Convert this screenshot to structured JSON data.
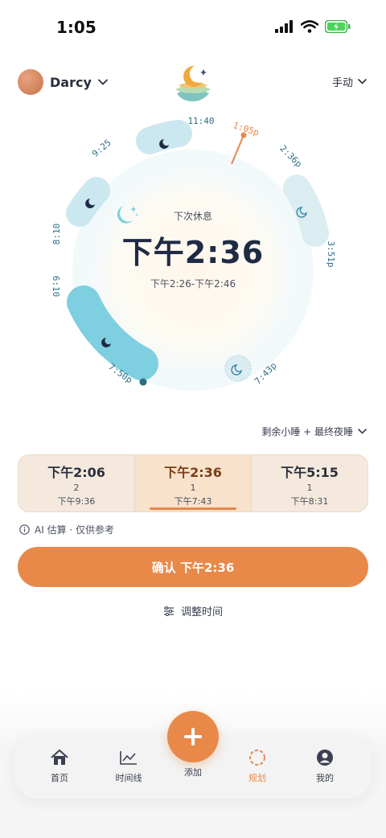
{
  "status": {
    "time": "1:05"
  },
  "header": {
    "profile_name": "Darcy",
    "mode_label": "手动"
  },
  "dial": {
    "tick_labels": [
      "11:40",
      "1:05p",
      "2:36p",
      "3:51p",
      "7:43p",
      "7:50p",
      "6:10",
      "8:10",
      "9:25"
    ],
    "center_label": "下次休息",
    "center_time": "下午2:36",
    "center_range": "下午2:26-下午2:46"
  },
  "dropdown_label": "剩余小睡 + 最终夜睡",
  "options": [
    {
      "time": "下午2:06",
      "count": "2",
      "bedtime": "下午9:36"
    },
    {
      "time": "下午2:36",
      "count": "1",
      "bedtime": "下午7:43"
    },
    {
      "time": "下午5:15",
      "count": "1",
      "bedtime": "下午8:31"
    }
  ],
  "ai_note": "AI 估算 · 仅供参考",
  "confirm_label": "确认 下午2:36",
  "adjust_label": "调整时间",
  "tabs": [
    {
      "label": "首页",
      "icon": "home-icon"
    },
    {
      "label": "时间线",
      "icon": "chart-icon"
    },
    {
      "label": "添加",
      "icon": "plus-icon"
    },
    {
      "label": "规划",
      "icon": "plan-icon"
    },
    {
      "label": "我的",
      "icon": "user-icon"
    }
  ],
  "colors": {
    "accent": "#e8894a",
    "nap": "#7ecfe0",
    "nap_light": "#cbe8f0",
    "navy": "#1f2a44"
  }
}
